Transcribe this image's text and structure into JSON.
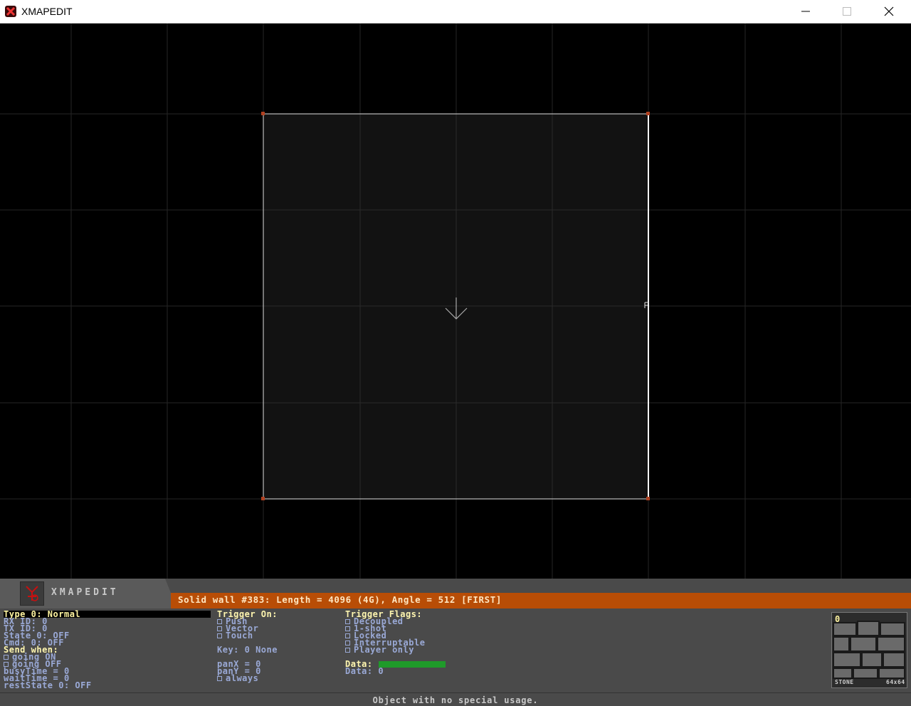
{
  "window": {
    "title": "XMAPEDIT"
  },
  "panel": {
    "logo_text": "XMAPEDIT",
    "status": "Solid wall #383: Length = 4096 (4G), Angle = 512 [FIRST]",
    "col1": {
      "type_line": "Type     0: Normal",
      "rx_line": "RX ID:    0",
      "tx_line": "TX ID:    0",
      "state_line": "State 0: OFF",
      "cmd_line": "Cmd:   0: OFF",
      "send_when": "Send when:",
      "going_on": "going ON",
      "going_off": "going OFF",
      "busy_line": "busyTime =     0",
      "wait_line": "waitTime =     0",
      "rest_line": "restState 0: OFF"
    },
    "col2": {
      "trigger_on": "Trigger On:",
      "push": "Push",
      "vector": "Vector",
      "touch": "Touch",
      "key_line": "Key: 0 None",
      "panx_line": "panX =     0",
      "pany_line": "panY =     0",
      "always": "always"
    },
    "col3": {
      "trigger_flags": "Trigger Flags:",
      "decoupled": "Decoupled",
      "one_shot": "1-shot",
      "locked": "Locked",
      "interruptable": "Interruptable",
      "player_only": "Player only",
      "data_head": "Data:",
      "data_line": "Data: 0"
    },
    "texture": {
      "index": "0",
      "name": "STONE",
      "size": "64x64"
    },
    "bottom_message": "Object with no special usage."
  },
  "colors": {
    "status_strip": "#b84d06",
    "panel_bg": "#4a4a4a",
    "highlight_text": "#fff4a0",
    "normal_text": "#9aa9d6",
    "data_bar": "#1f9a2a"
  }
}
